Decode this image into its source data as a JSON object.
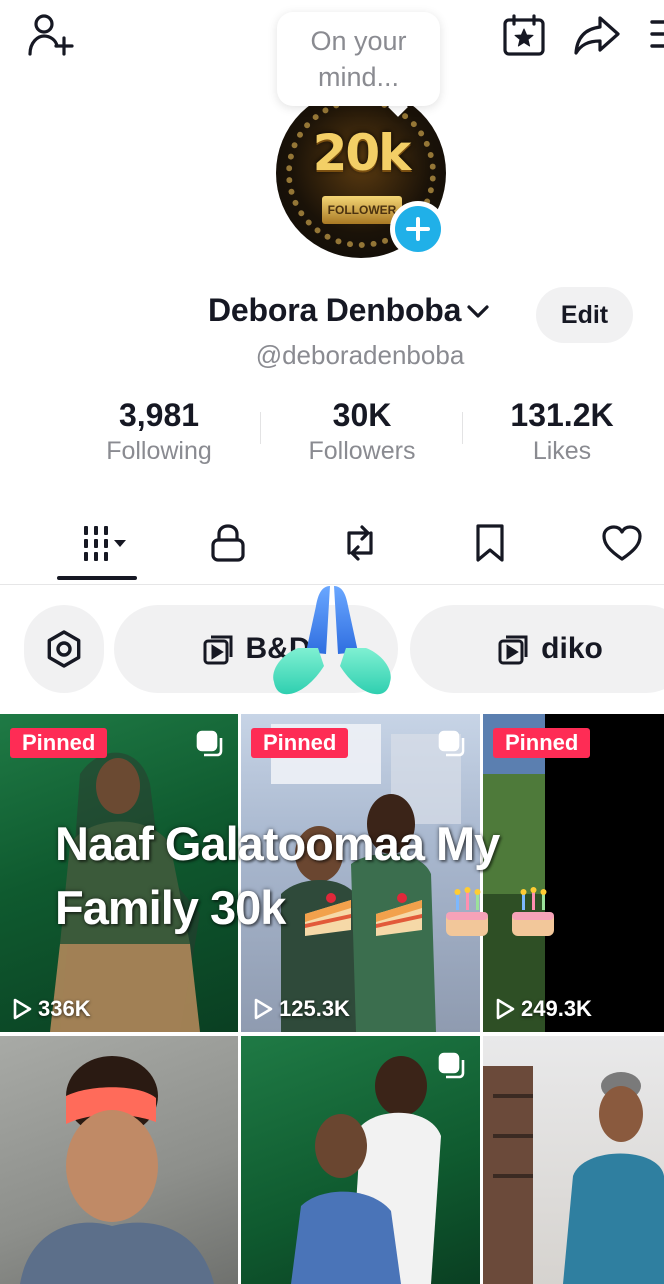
{
  "tooltip": {
    "text": "On your mind..."
  },
  "avatar": {
    "overlay_text": "20k",
    "plate_text": "FOLLOWER"
  },
  "profile": {
    "display_name": "Debora Denboba",
    "handle": "@deboradenboba",
    "edit_label": "Edit"
  },
  "stats": [
    {
      "value": "3,981",
      "label": "Following"
    },
    {
      "value": "30K",
      "label": "Followers"
    },
    {
      "value": "131.2K",
      "label": "Likes"
    }
  ],
  "tabs": [
    "videos-grid",
    "private",
    "reposts",
    "favorites",
    "liked"
  ],
  "playlists": [
    {
      "label": "B&D"
    },
    {
      "label": "diko"
    }
  ],
  "grid_overlay_title": "Naaf Galatoomaa My Family 30k",
  "grid": [
    {
      "pinned": "Pinned",
      "views": "336K"
    },
    {
      "pinned": "Pinned",
      "views": "125.3K"
    },
    {
      "pinned": "Pinned",
      "views": "249.3K"
    },
    {
      "pinned": "",
      "views": ""
    },
    {
      "pinned": "",
      "views": ""
    },
    {
      "pinned": "",
      "views": ""
    }
  ],
  "colors": {
    "accent": "#fe2c55",
    "blue_badge": "#20b0e8",
    "muted_text": "#8a8b91"
  }
}
